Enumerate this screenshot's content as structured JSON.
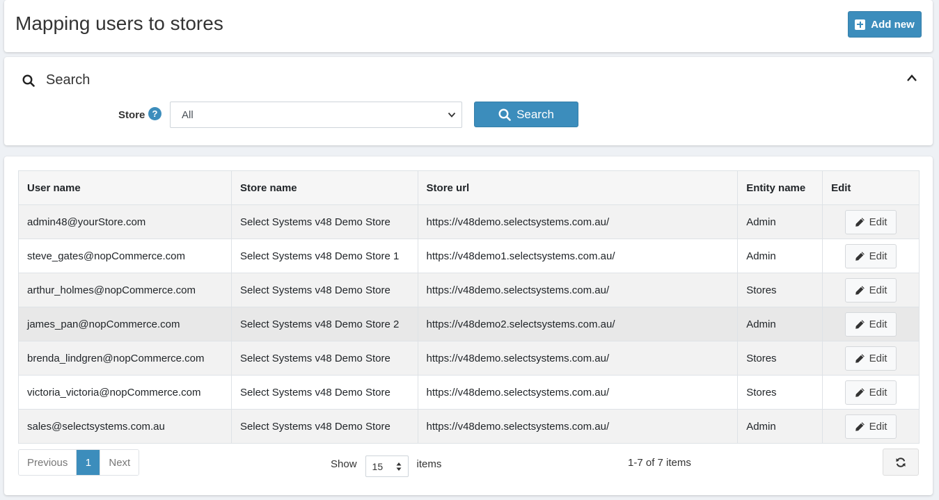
{
  "header": {
    "title": "Mapping users to stores",
    "add_new_label": "Add new",
    "accent": "#3c8dbc"
  },
  "search": {
    "title": "Search",
    "store_label": "Store",
    "help_symbol": "?",
    "store_selected": "All",
    "button_label": "Search"
  },
  "grid": {
    "columns": [
      "User name",
      "Store name",
      "Store url",
      "Entity name",
      "Edit"
    ],
    "edit_label": "Edit",
    "rows": [
      {
        "user": "admin48@yourStore.com",
        "store": "Select Systems v48 Demo Store",
        "url": "https://v48demo.selectsystems.com.au/",
        "entity": "Admin"
      },
      {
        "user": "steve_gates@nopCommerce.com",
        "store": "Select Systems v48 Demo Store 1",
        "url": "https://v48demo1.selectsystems.com.au/",
        "entity": "Admin"
      },
      {
        "user": "arthur_holmes@nopCommerce.com",
        "store": "Select Systems v48 Demo Store",
        "url": "https://v48demo.selectsystems.com.au/",
        "entity": "Stores"
      },
      {
        "user": "james_pan@nopCommerce.com",
        "store": "Select Systems v48 Demo Store 2",
        "url": "https://v48demo2.selectsystems.com.au/",
        "entity": "Admin"
      },
      {
        "user": "brenda_lindgren@nopCommerce.com",
        "store": "Select Systems v48 Demo Store",
        "url": "https://v48demo.selectsystems.com.au/",
        "entity": "Stores"
      },
      {
        "user": "victoria_victoria@nopCommerce.com",
        "store": "Select Systems v48 Demo Store",
        "url": "https://v48demo.selectsystems.com.au/",
        "entity": "Stores"
      },
      {
        "user": "sales@selectsystems.com.au",
        "store": "Select Systems v48 Demo Store",
        "url": "https://v48demo.selectsystems.com.au/",
        "entity": "Admin"
      }
    ]
  },
  "pager": {
    "previous_label": "Previous",
    "current_page": "1",
    "next_label": "Next",
    "show_label": "Show",
    "page_size": "15",
    "items_label": "items",
    "range_info": "1-7 of 7 items"
  }
}
